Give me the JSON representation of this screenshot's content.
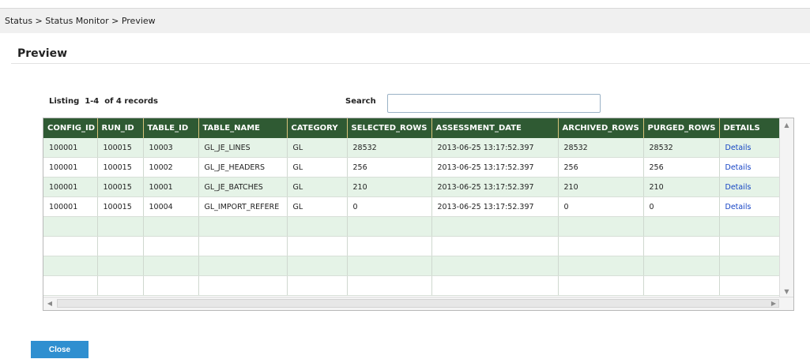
{
  "breadcrumb": "Status > Status Monitor > Preview",
  "page_title": "Preview",
  "listing": "Listing  1-4  of 4 records",
  "search": {
    "label": "Search",
    "value": ""
  },
  "table": {
    "columns": [
      "CONFIG_ID",
      "RUN_ID",
      "TABLE_ID",
      "TABLE_NAME",
      "CATEGORY",
      "SELECTED_ROWS",
      "ASSESSMENT_DATE",
      "ARCHIVED_ROWS",
      "PURGED_ROWS",
      "DETAILS"
    ],
    "rows": [
      [
        "100001",
        "100015",
        "10003",
        "GL_JE_LINES",
        "GL",
        "28532",
        "2013-06-25 13:17:52.397",
        "28532",
        "28532",
        "Details"
      ],
      [
        "100001",
        "100015",
        "10002",
        "GL_JE_HEADERS",
        "GL",
        "256",
        "2013-06-25 13:17:52.397",
        "256",
        "256",
        "Details"
      ],
      [
        "100001",
        "100015",
        "10001",
        "GL_JE_BATCHES",
        "GL",
        "210",
        "2013-06-25 13:17:52.397",
        "210",
        "210",
        "Details"
      ],
      [
        "100001",
        "100015",
        "10004",
        "GL_IMPORT_REFERE",
        "GL",
        "0",
        "2013-06-25 13:17:52.397",
        "0",
        "0",
        "Details"
      ],
      [
        "",
        "",
        "",
        "",
        "",
        "",
        "",
        "",
        "",
        ""
      ],
      [
        "",
        "",
        "",
        "",
        "",
        "",
        "",
        "",
        "",
        ""
      ],
      [
        "",
        "",
        "",
        "",
        "",
        "",
        "",
        "",
        "",
        ""
      ],
      [
        "",
        "",
        "",
        "",
        "",
        "",
        "",
        "",
        "",
        ""
      ]
    ]
  },
  "close_label": "Close",
  "icons": {
    "scroll_up": "scroll-up-arrow-icon",
    "scroll_down": "scroll-down-arrow-icon",
    "scroll_left": "scroll-left-arrow-icon",
    "scroll_right": "scroll-right-arrow-icon"
  },
  "colors": {
    "header_bg": "#2f5a33",
    "row_alt_bg": "#e5f3e7",
    "link": "#1544c4",
    "button": "#2f8fd0"
  }
}
